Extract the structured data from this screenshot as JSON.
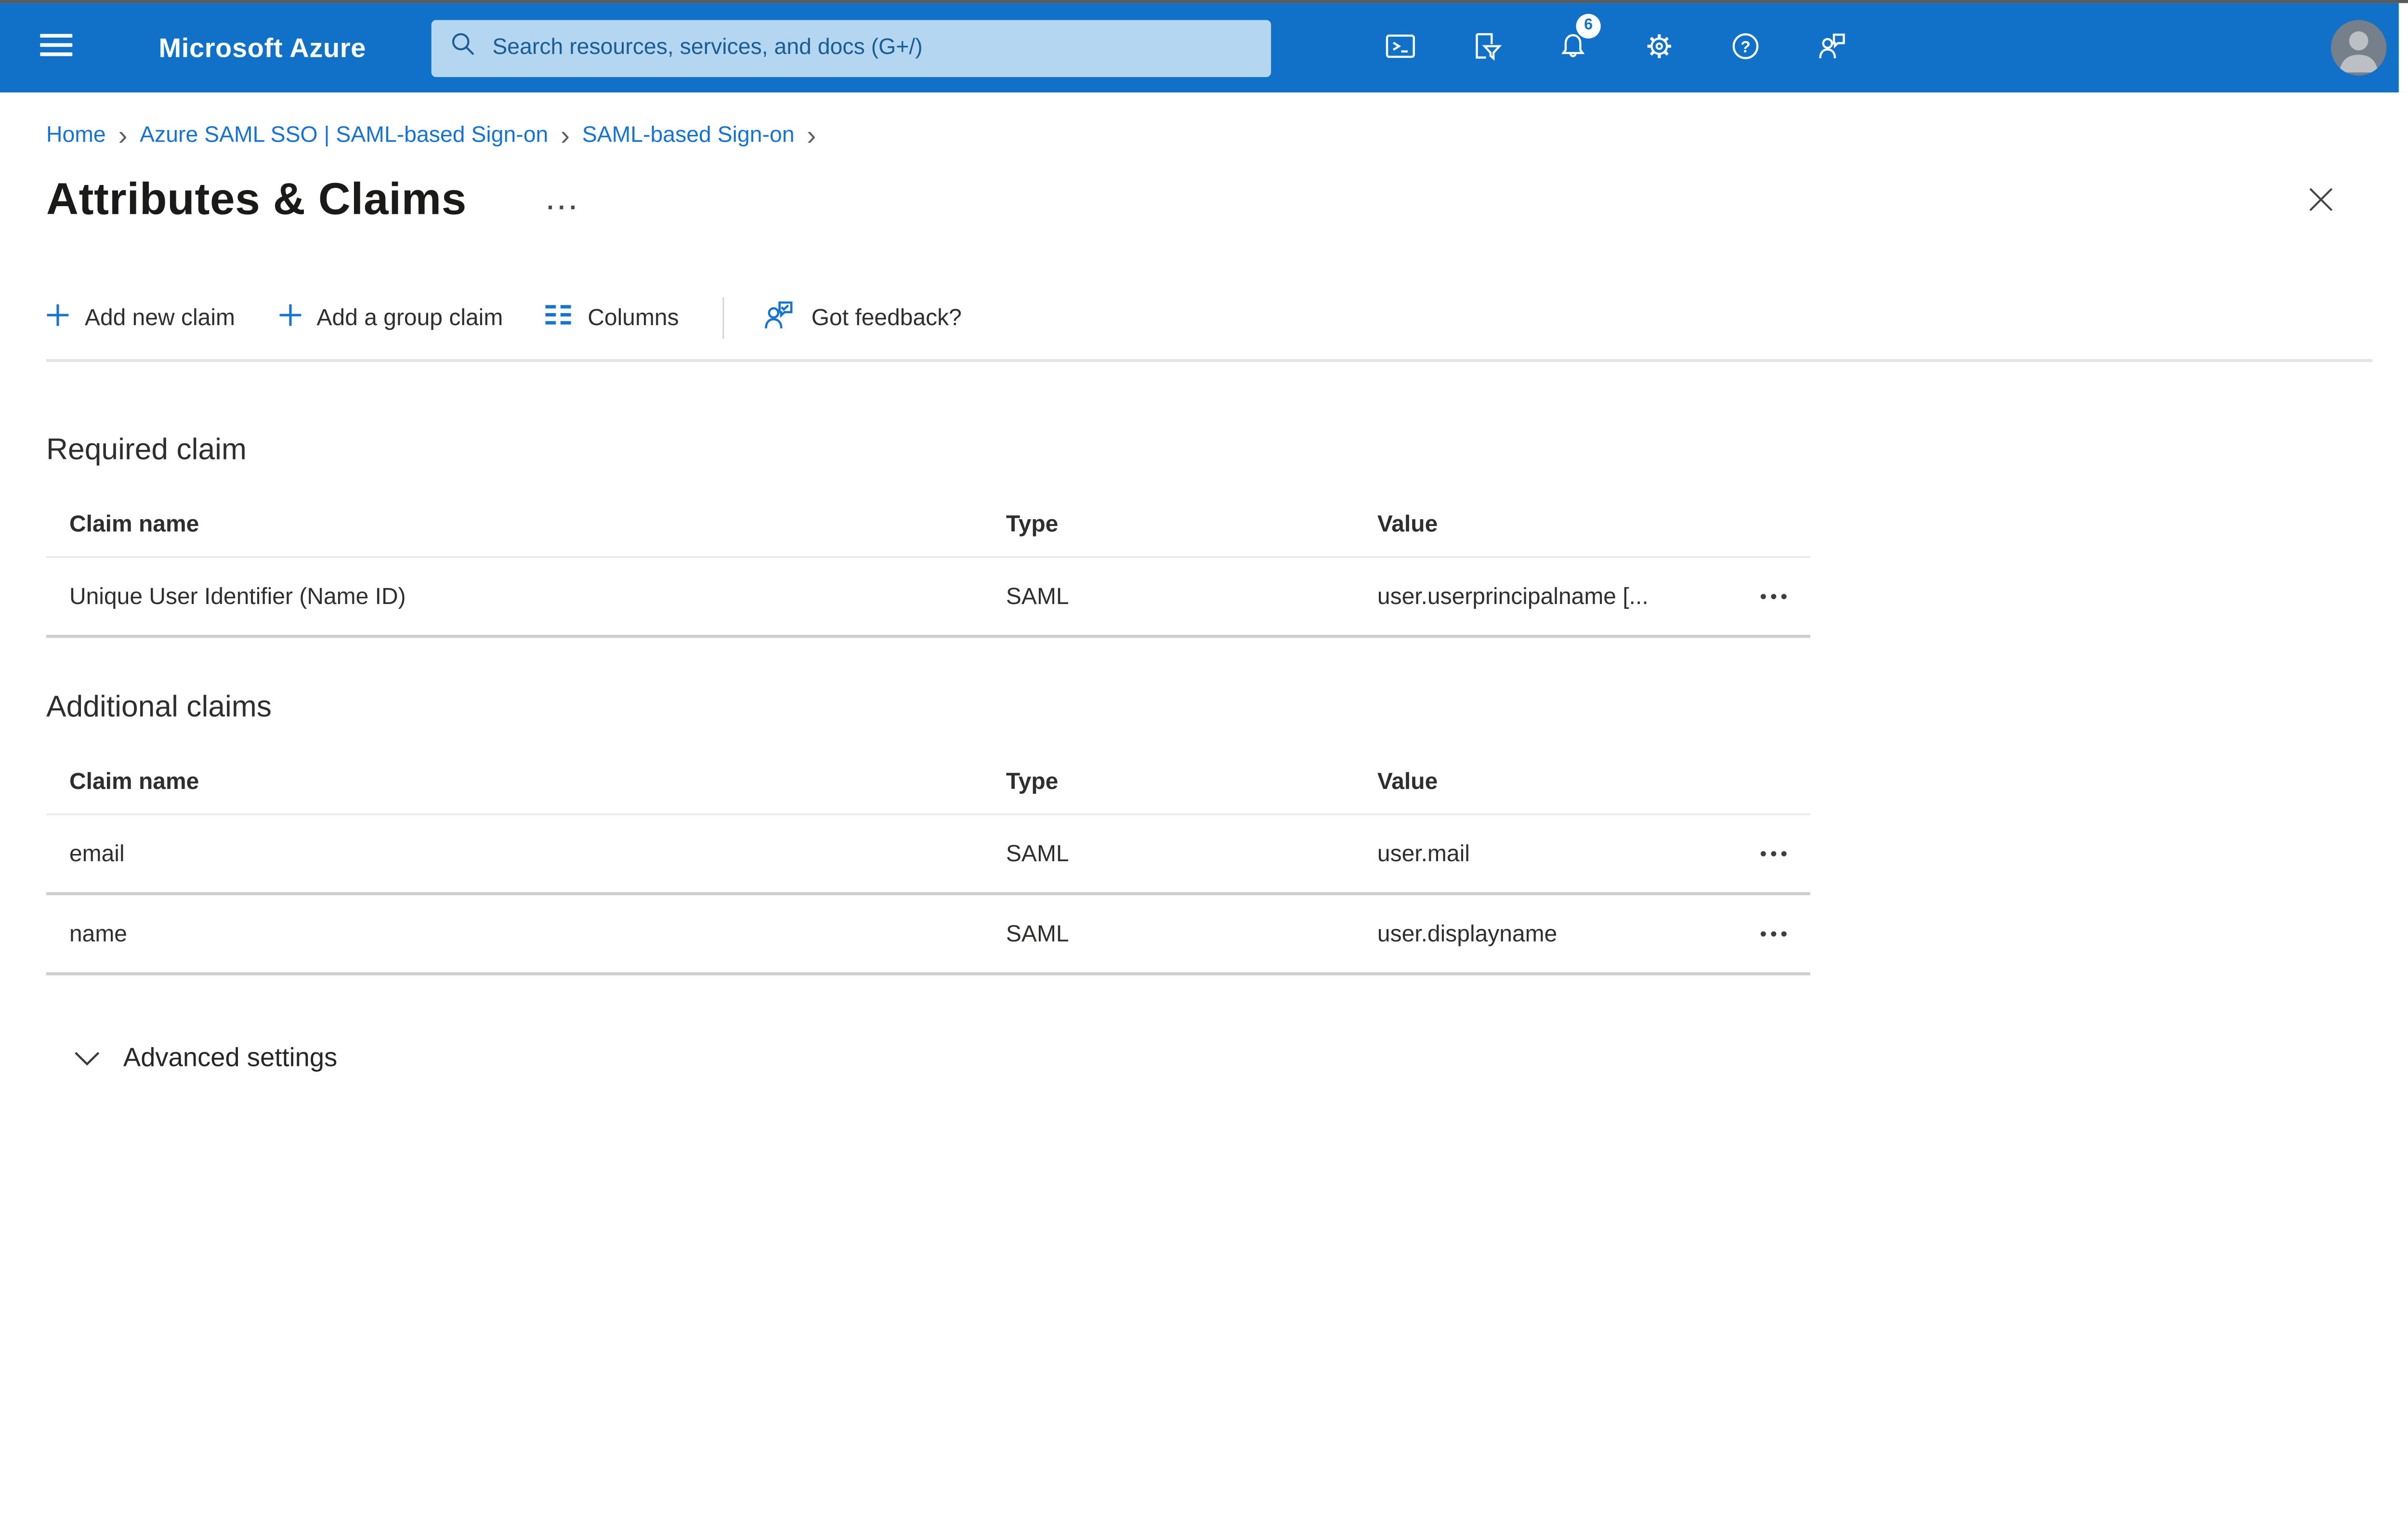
{
  "colors": {
    "header_bar": "#1171c8",
    "accent": "#1673d3",
    "search_bg": "#b4d6f0",
    "search_text": "#1a5c96",
    "badge_bg": "#ffffff",
    "badge_text": "#1171c8",
    "text_primary": "#2f2e2d",
    "divider": "#e3e3e3",
    "row_border": "#d0cecc",
    "avatar_bg": "#75808b",
    "avatar_fg": "#bcc0c4"
  },
  "header": {
    "brand": "Microsoft Azure",
    "search_placeholder": "Search resources, services, and docs (G+/)",
    "notification_count": "6"
  },
  "icons": {
    "menu": "hamburger-menu",
    "search": "magnifier",
    "cloud_shell": "terminal-window",
    "directory_filter": "document-funnel",
    "notifications": "bell",
    "settings": "gear",
    "help": "question-circle",
    "feedback": "person-speech-bubble",
    "avatar": "person-silhouette",
    "add": "plus",
    "columns": "column-bars",
    "more": "ellipsis",
    "close": "x",
    "advanced_chevron": "chevron-down"
  },
  "breadcrumb": {
    "separator": "›",
    "items": [
      {
        "label": "Home"
      },
      {
        "label": "Azure SAML SSO | SAML-based Sign-on"
      },
      {
        "label": "SAML-based Sign-on"
      }
    ]
  },
  "page": {
    "title": "Attributes & Claims",
    "more_glyph": "···"
  },
  "toolbar": {
    "add_new_claim": "Add new claim",
    "add_group_claim": "Add a group claim",
    "columns": "Columns",
    "feedback": "Got feedback?"
  },
  "required_section": {
    "heading": "Required claim",
    "columns": [
      "Claim name",
      "Type",
      "Value"
    ],
    "rows": [
      {
        "claim_name": "Unique User Identifier (Name ID)",
        "type": "SAML",
        "value": "user.userprincipalname [..."
      }
    ]
  },
  "additional_section": {
    "heading": "Additional claims",
    "columns": [
      "Claim name",
      "Type",
      "Value"
    ],
    "rows": [
      {
        "claim_name": "email",
        "type": "SAML",
        "value": "user.mail"
      },
      {
        "claim_name": "name",
        "type": "SAML",
        "value": "user.displayname"
      }
    ]
  },
  "advanced": {
    "label": "Advanced settings"
  },
  "glyphs": {
    "row_menu": "•••"
  }
}
